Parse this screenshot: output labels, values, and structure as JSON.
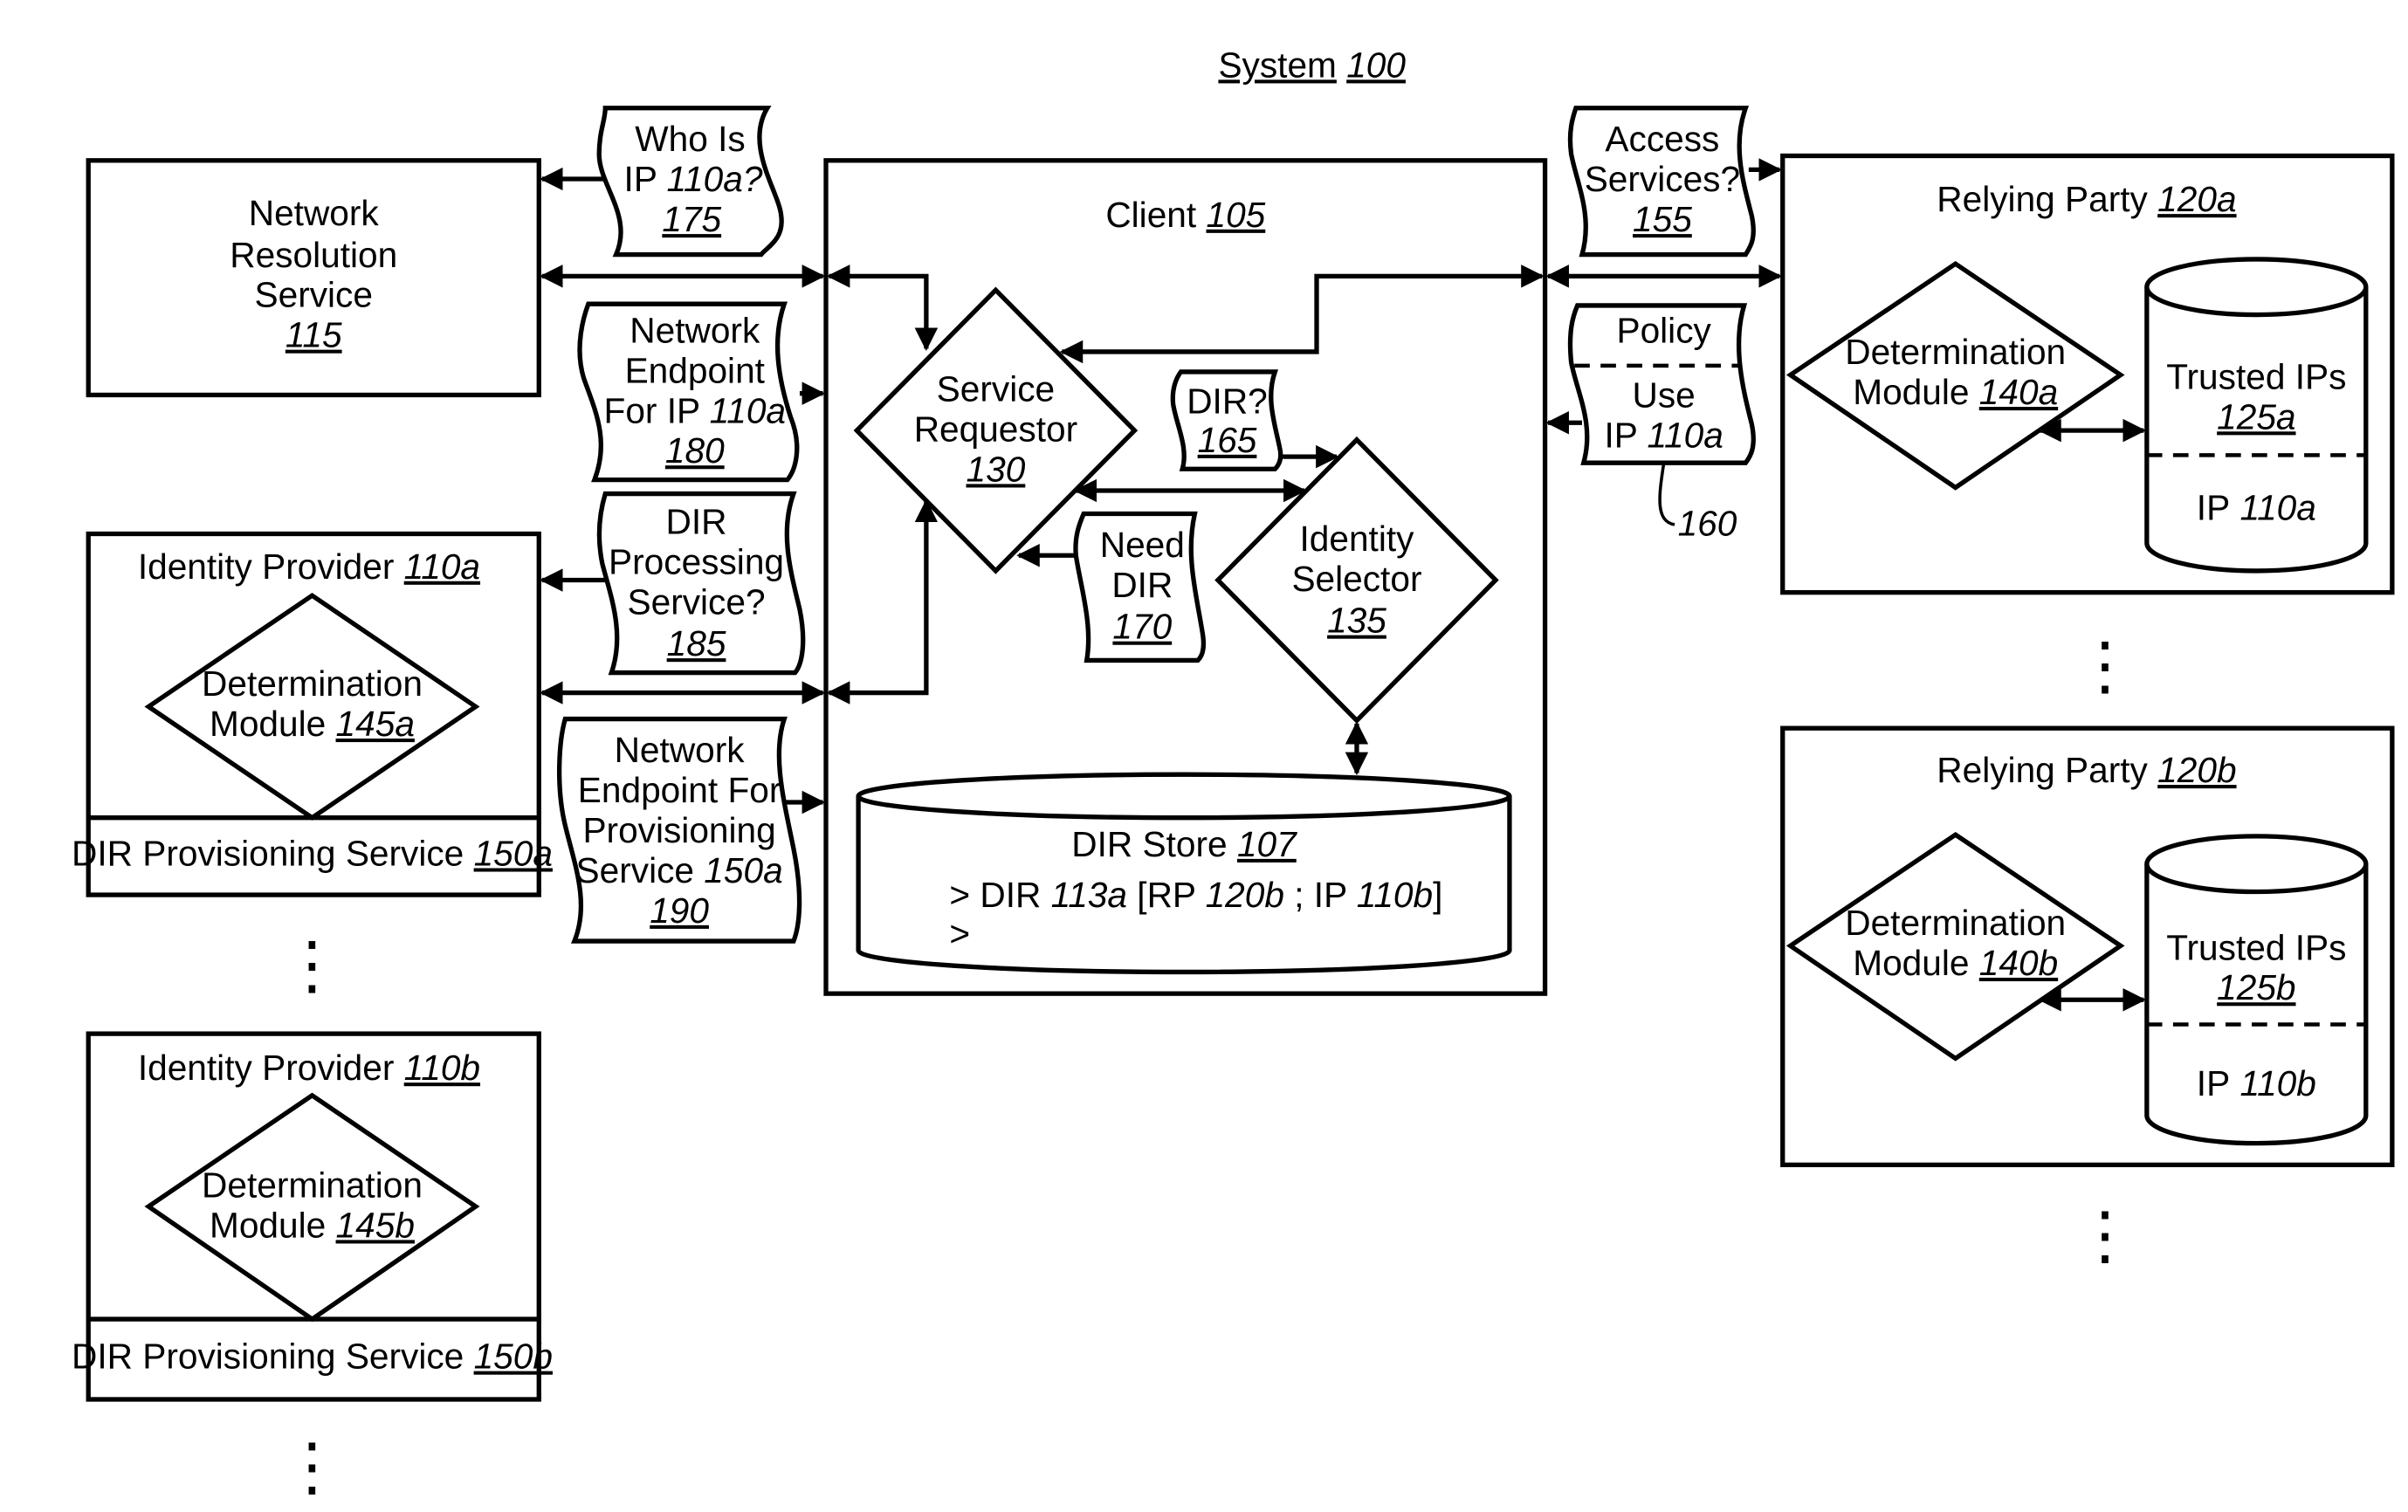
{
  "title": {
    "label": "System",
    "ref": "100"
  },
  "network_resolution": {
    "lines": [
      "Network",
      "Resolution",
      "Service"
    ],
    "ref": "115"
  },
  "client": {
    "label": "Client",
    "ref": "105"
  },
  "service_requestor": {
    "lines": [
      "Service",
      "Requestor"
    ],
    "ref": "130"
  },
  "identity_selector": {
    "lines": [
      "Identity",
      "Selector"
    ],
    "ref": "135"
  },
  "dir_store": {
    "label": "DIR Store",
    "ref": "107",
    "entries": [
      {
        "prefix": "> DIR ",
        "dir": "113a",
        "rp_label": " [RP ",
        "rp": "120b",
        "ip_label": " ; IP ",
        "ip": "110b",
        "suffix": "]"
      },
      {
        "prefix": ">"
      }
    ]
  },
  "identity_providers": [
    {
      "label": "Identity Provider",
      "ref": "110a",
      "module": {
        "lines": [
          "Determination",
          "Module"
        ],
        "ref": "145a"
      },
      "service": {
        "label": "DIR Provisioning Service",
        "ref": "150a"
      }
    },
    {
      "label": "Identity Provider",
      "ref": "110b",
      "module": {
        "lines": [
          "Determination",
          "Module"
        ],
        "ref": "145b"
      },
      "service": {
        "label": "DIR Provisioning Service",
        "ref": "150b"
      }
    }
  ],
  "relying_parties": [
    {
      "label": "Relying Party",
      "ref": "120a",
      "module": {
        "lines": [
          "Determination",
          "Module"
        ],
        "ref": "140a"
      },
      "store": {
        "label": "Trusted IPs",
        "ref": "125a",
        "entry_label": "IP",
        "entry_ref": "110a"
      }
    },
    {
      "label": "Relying Party",
      "ref": "120b",
      "module": {
        "lines": [
          "Determination",
          "Module"
        ],
        "ref": "140b"
      },
      "store": {
        "label": "Trusted IPs",
        "ref": "125b",
        "entry_label": "IP",
        "entry_ref": "110b"
      }
    }
  ],
  "messages": {
    "who_is": {
      "lines": [
        "Who Is",
        "IP "
      ],
      "italic": "110a?",
      "ref": "175"
    },
    "endpoint_ip": {
      "lines": [
        "Network",
        "Endpoint",
        "For IP "
      ],
      "italic": "110a",
      "ref": "180"
    },
    "dir_processing": {
      "lines": [
        "DIR",
        "Processing",
        "Service?"
      ],
      "ref": "185"
    },
    "endpoint_prov": {
      "lines": [
        "Network",
        "Endpoint For",
        "Provisioning",
        "Service "
      ],
      "italic": "150a",
      "ref": "190"
    },
    "dir_query": {
      "lines": [
        "DIR?"
      ],
      "ref": "165"
    },
    "need_dir": {
      "lines": [
        "Need",
        "DIR"
      ],
      "ref": "170"
    },
    "access_services": {
      "lines": [
        "Access",
        "Services?"
      ],
      "ref": "155"
    },
    "policy": {
      "top": "Policy",
      "lines": [
        "Use",
        "IP "
      ],
      "italic": "110a",
      "ref": "160"
    }
  },
  "ellipsis": "⋮"
}
